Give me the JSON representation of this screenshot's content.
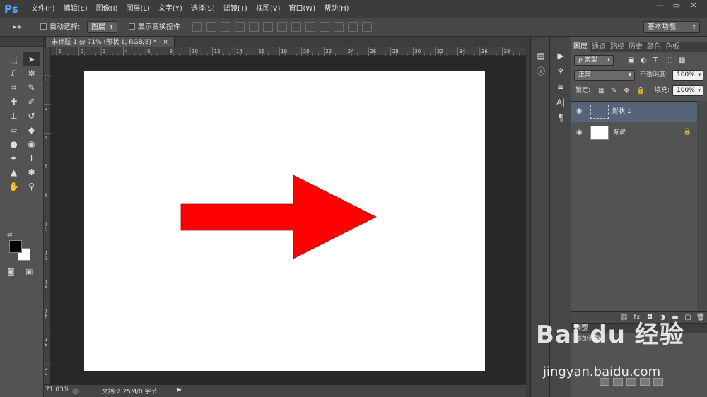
{
  "app": {
    "logo": "Ps"
  },
  "menu": [
    "文件(F)",
    "编辑(E)",
    "图像(I)",
    "图层(L)",
    "文字(Y)",
    "选择(S)",
    "滤镜(T)",
    "视图(V)",
    "窗口(W)",
    "帮助(H)"
  ],
  "window_controls": {
    "minimize": "—",
    "restore": "▭",
    "close": "✕"
  },
  "options": {
    "move_tool": "▸+",
    "auto_select_label": "自动选择:",
    "auto_select_value": "图层",
    "show_transform_label": "显示变换控件",
    "workspace": "基本功能"
  },
  "document": {
    "tab_title": "未标题-1 @ 71% (形状 1, RGB/8) *",
    "close": "×",
    "ruler_marks_h": [
      "2",
      "0",
      "2",
      "4",
      "6",
      "8",
      "10",
      "12",
      "14",
      "16",
      "18",
      "20",
      "22",
      "24",
      "26",
      "28",
      "30",
      "32",
      "34",
      "36",
      "38"
    ],
    "ruler_marks_v": [
      "0",
      "2",
      "4",
      "6",
      "8",
      "1\n0",
      "1\n2",
      "1\n4",
      "1\n6",
      "1\n8",
      "2\n0"
    ],
    "arrow_color": "#ff0000",
    "canvas_color": "#ffffff"
  },
  "status": {
    "zoom": "71.03%",
    "doc_info": "文档:2.25M/0 字节",
    "arrow": "▶"
  },
  "panel": {
    "tabs": [
      "图层",
      "通道",
      "路径",
      "历史",
      "颜色",
      "色板"
    ],
    "filter_label": "ρ 类型",
    "blend_mode": "正常",
    "opacity_label": "不透明度:",
    "opacity_value": "100%",
    "lock_label": "锁定:",
    "fill_label": "填充:",
    "fill_value": "100%",
    "layers": [
      {
        "name": "形状 1",
        "selected": true
      },
      {
        "name": "背景",
        "selected": false,
        "locked": true
      }
    ],
    "adjust_tab": "调整",
    "adjust_text": "添加调整"
  },
  "watermark": {
    "brand": "Bai du 经验",
    "url": "jingyan.baidu.com"
  }
}
